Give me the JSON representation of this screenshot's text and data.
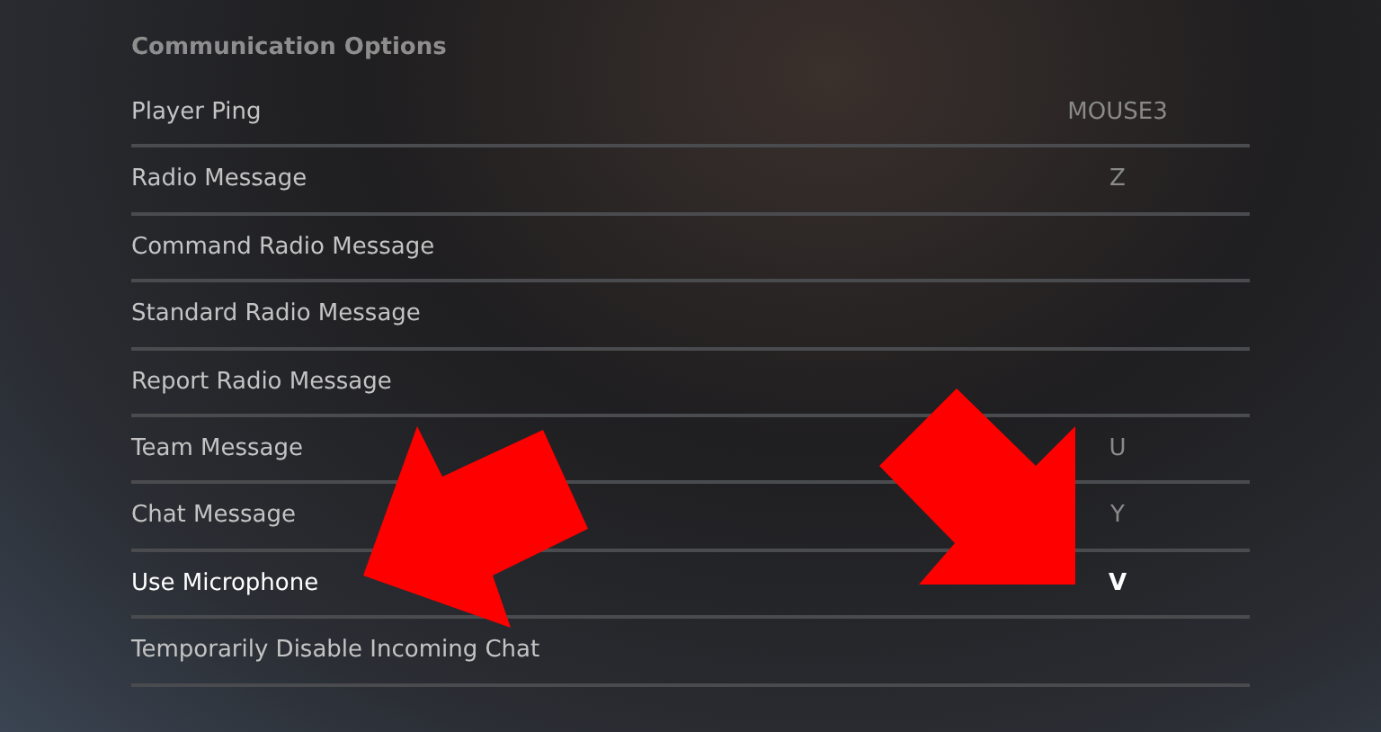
{
  "section_title": "Communication Options",
  "rows": [
    {
      "action": "Player Ping",
      "key": "MOUSE3",
      "selected": false
    },
    {
      "action": "Radio Message",
      "key": "Z",
      "selected": false
    },
    {
      "action": "Command Radio Message",
      "selected": false
    },
    {
      "action": "Standard Radio Message",
      "selected": false
    },
    {
      "action": "Report Radio Message",
      "selected": false
    },
    {
      "action": "Team Message",
      "key": "U",
      "selected": false
    },
    {
      "action": "Chat Message",
      "key": "Y",
      "selected": false
    },
    {
      "action": "Use Microphone",
      "key": "V",
      "selected": true
    },
    {
      "action": "Temporarily Disable Incoming Chat",
      "selected": false
    }
  ],
  "annotations": [
    {
      "kind": "arrow"
    },
    {
      "kind": "arrow"
    }
  ]
}
